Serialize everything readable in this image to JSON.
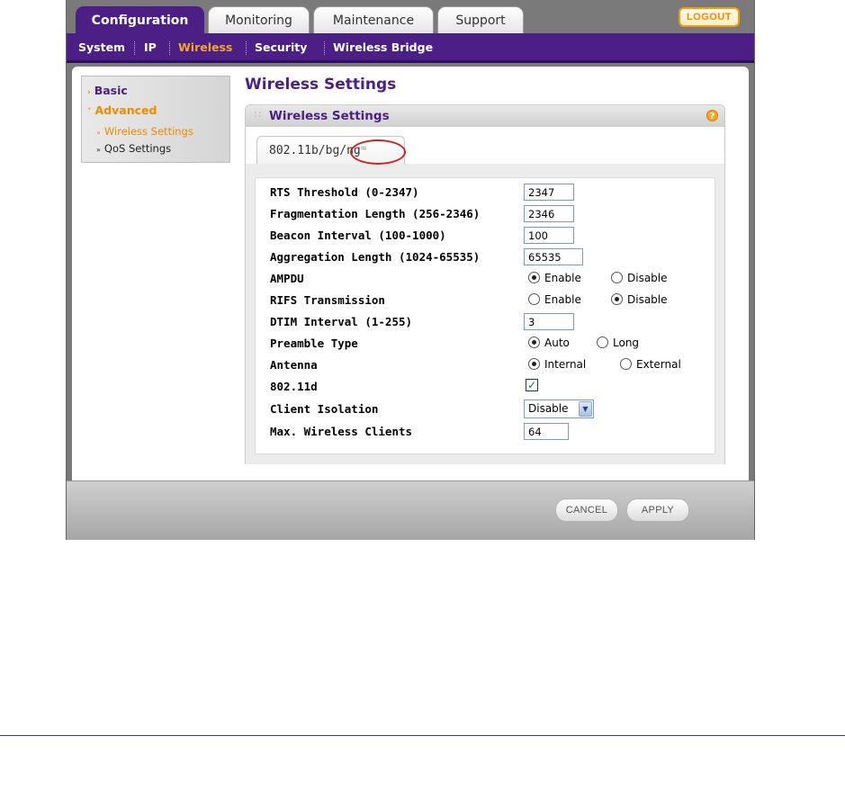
{
  "main_tabs": [
    {
      "label": "Configuration",
      "active": true
    },
    {
      "label": "Monitoring",
      "active": false
    },
    {
      "label": "Maintenance",
      "active": false
    },
    {
      "label": "Support",
      "active": false
    }
  ],
  "logout_label": "LOGOUT",
  "subnav": [
    {
      "label": "System",
      "active": false
    },
    {
      "label": "IP",
      "active": false
    },
    {
      "label": "Wireless",
      "active": true
    },
    {
      "label": "Security",
      "active": false
    },
    {
      "label": "Wireless Bridge",
      "active": false
    }
  ],
  "leftnav": {
    "basic": "Basic",
    "advanced": "Advanced",
    "wireless_settings": "Wireless Settings",
    "qos_settings": "QoS Settings"
  },
  "page_title": "Wireless Settings",
  "panel_title": "Wireless Settings",
  "help_icon": "?",
  "radio_tab": "802.11b/bg/ng",
  "form": {
    "rts": {
      "label": "RTS Threshold (0-2347)",
      "value": "2347"
    },
    "frag": {
      "label": "Fragmentation Length (256-2346)",
      "value": "2346"
    },
    "beacon": {
      "label": "Beacon Interval (100-1000)",
      "value": "100"
    },
    "aggregation": {
      "label": "Aggregation Length (1024-65535)",
      "value": "65535"
    },
    "ampdu": {
      "label": "AMPDU",
      "opt1": "Enable",
      "opt2": "Disable",
      "selected": "Enable"
    },
    "rifs": {
      "label": "RIFS Transmission",
      "opt1": "Enable",
      "opt2": "Disable",
      "selected": "Disable"
    },
    "dtim": {
      "label": "DTIM Interval (1-255)",
      "value": "3"
    },
    "preamble": {
      "label": "Preamble Type",
      "opt1": "Auto",
      "opt2": "Long",
      "selected": "Auto"
    },
    "antenna": {
      "label": "Antenna",
      "opt1": "Internal",
      "opt2": "External",
      "selected": "Internal"
    },
    "dot11d": {
      "label": "802.11d",
      "checked": true
    },
    "isolation": {
      "label": "Client Isolation",
      "value": "Disable"
    },
    "maxclients": {
      "label": "Max. Wireless Clients",
      "value": "64"
    }
  },
  "buttons": {
    "cancel": "CANCEL",
    "apply": "APPLY"
  },
  "colors": {
    "brand_purple": "#4b1f86",
    "accent_orange": "#f5a623",
    "highlight_red": "#d42020"
  }
}
